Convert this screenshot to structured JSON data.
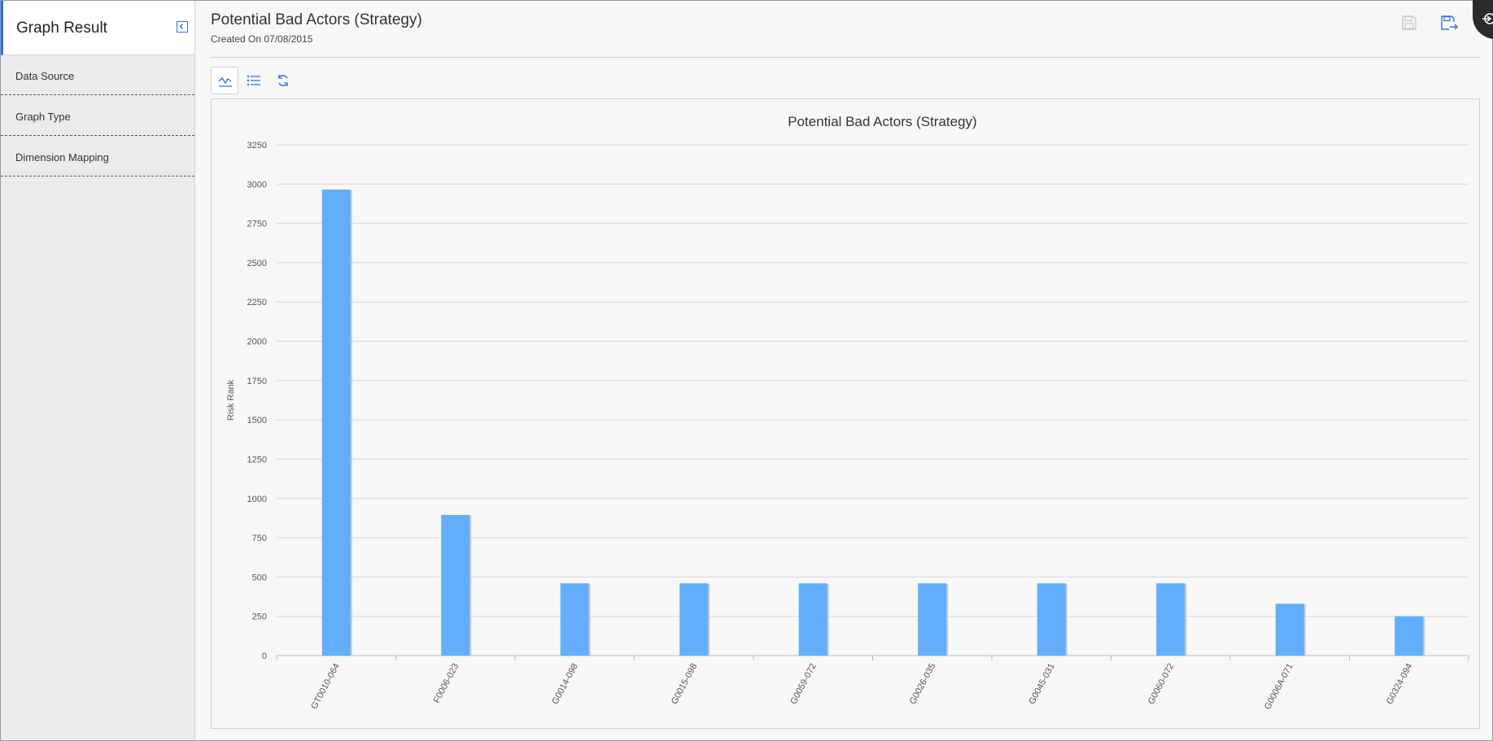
{
  "sidebar": {
    "title": "Graph Result",
    "items": [
      {
        "label": "Data Source"
      },
      {
        "label": "Graph Type"
      },
      {
        "label": "Dimension Mapping"
      }
    ]
  },
  "header": {
    "title": "Potential Bad Actors (Strategy)",
    "subtitle": "Created On 07/08/2015"
  },
  "icons": {
    "collapse": "chevron-left-icon",
    "save": "save-icon",
    "save_as": "save-as-icon",
    "chart_view": "line-chart-icon",
    "list_view": "list-icon",
    "refresh": "refresh-icon"
  },
  "colors": {
    "accent": "#2f6fd6",
    "bar": "#62aefc"
  },
  "chart_data": {
    "type": "bar",
    "title": "Potential Bad Actors (Strategy)",
    "xlabel": "",
    "ylabel": "Risk Rank",
    "categories": [
      "GT0010-064",
      "F0006-023",
      "G0014-098",
      "G0015-098",
      "G0059-072",
      "G0026-035",
      "G0045-031",
      "G0060-072",
      "G0006A-071",
      "G0324-094"
    ],
    "values": [
      2965,
      895,
      460,
      460,
      460,
      460,
      460,
      460,
      330,
      250
    ],
    "ylim": [
      0,
      3250
    ],
    "yticks": [
      0,
      250,
      500,
      750,
      1000,
      1250,
      1500,
      1750,
      2000,
      2250,
      2500,
      2750,
      3000,
      3250
    ],
    "grid": true
  }
}
